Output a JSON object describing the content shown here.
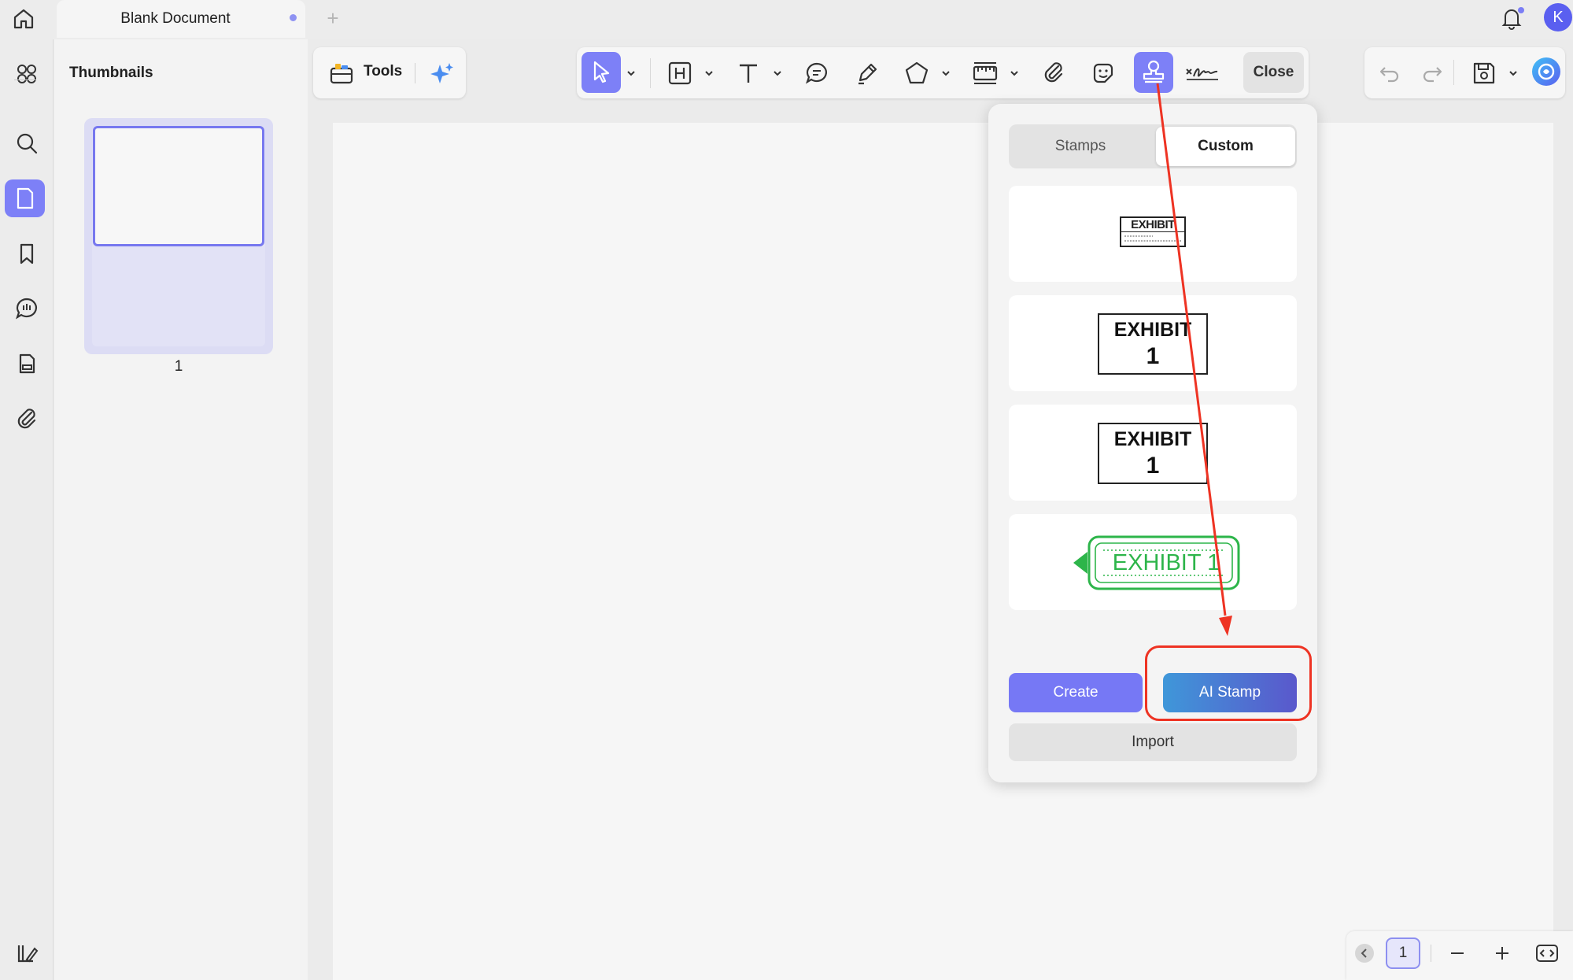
{
  "tab": {
    "title": "Blank Document",
    "add": "+"
  },
  "avatar": {
    "initial": "K"
  },
  "thumbnails": {
    "title": "Thumbnails",
    "page_number": "1"
  },
  "toolbar": {
    "tools_label": "Tools",
    "close_label": "Close"
  },
  "stamp_panel": {
    "tabs": [
      {
        "label": "Stamps",
        "active": false
      },
      {
        "label": "Custom",
        "active": true
      }
    ],
    "stamps": [
      {
        "text": "EXHIBIT",
        "style": "small-form"
      },
      {
        "text": "EXHIBIT",
        "number": "1",
        "style": "boxed"
      },
      {
        "text": "EXHIBIT",
        "number": "1",
        "style": "boxed"
      },
      {
        "text": "EXHIBIT 1",
        "style": "green-tag",
        "color": "#2db54a"
      }
    ],
    "create_label": "Create",
    "ai_stamp_label": "AI Stamp",
    "import_label": "Import"
  },
  "pager": {
    "current_page": "1"
  },
  "colors": {
    "accent": "#7d80f7",
    "annotation": "#ee3323",
    "ai_gradient_start": "#3f97d9",
    "ai_gradient_end": "#5a58cc"
  }
}
